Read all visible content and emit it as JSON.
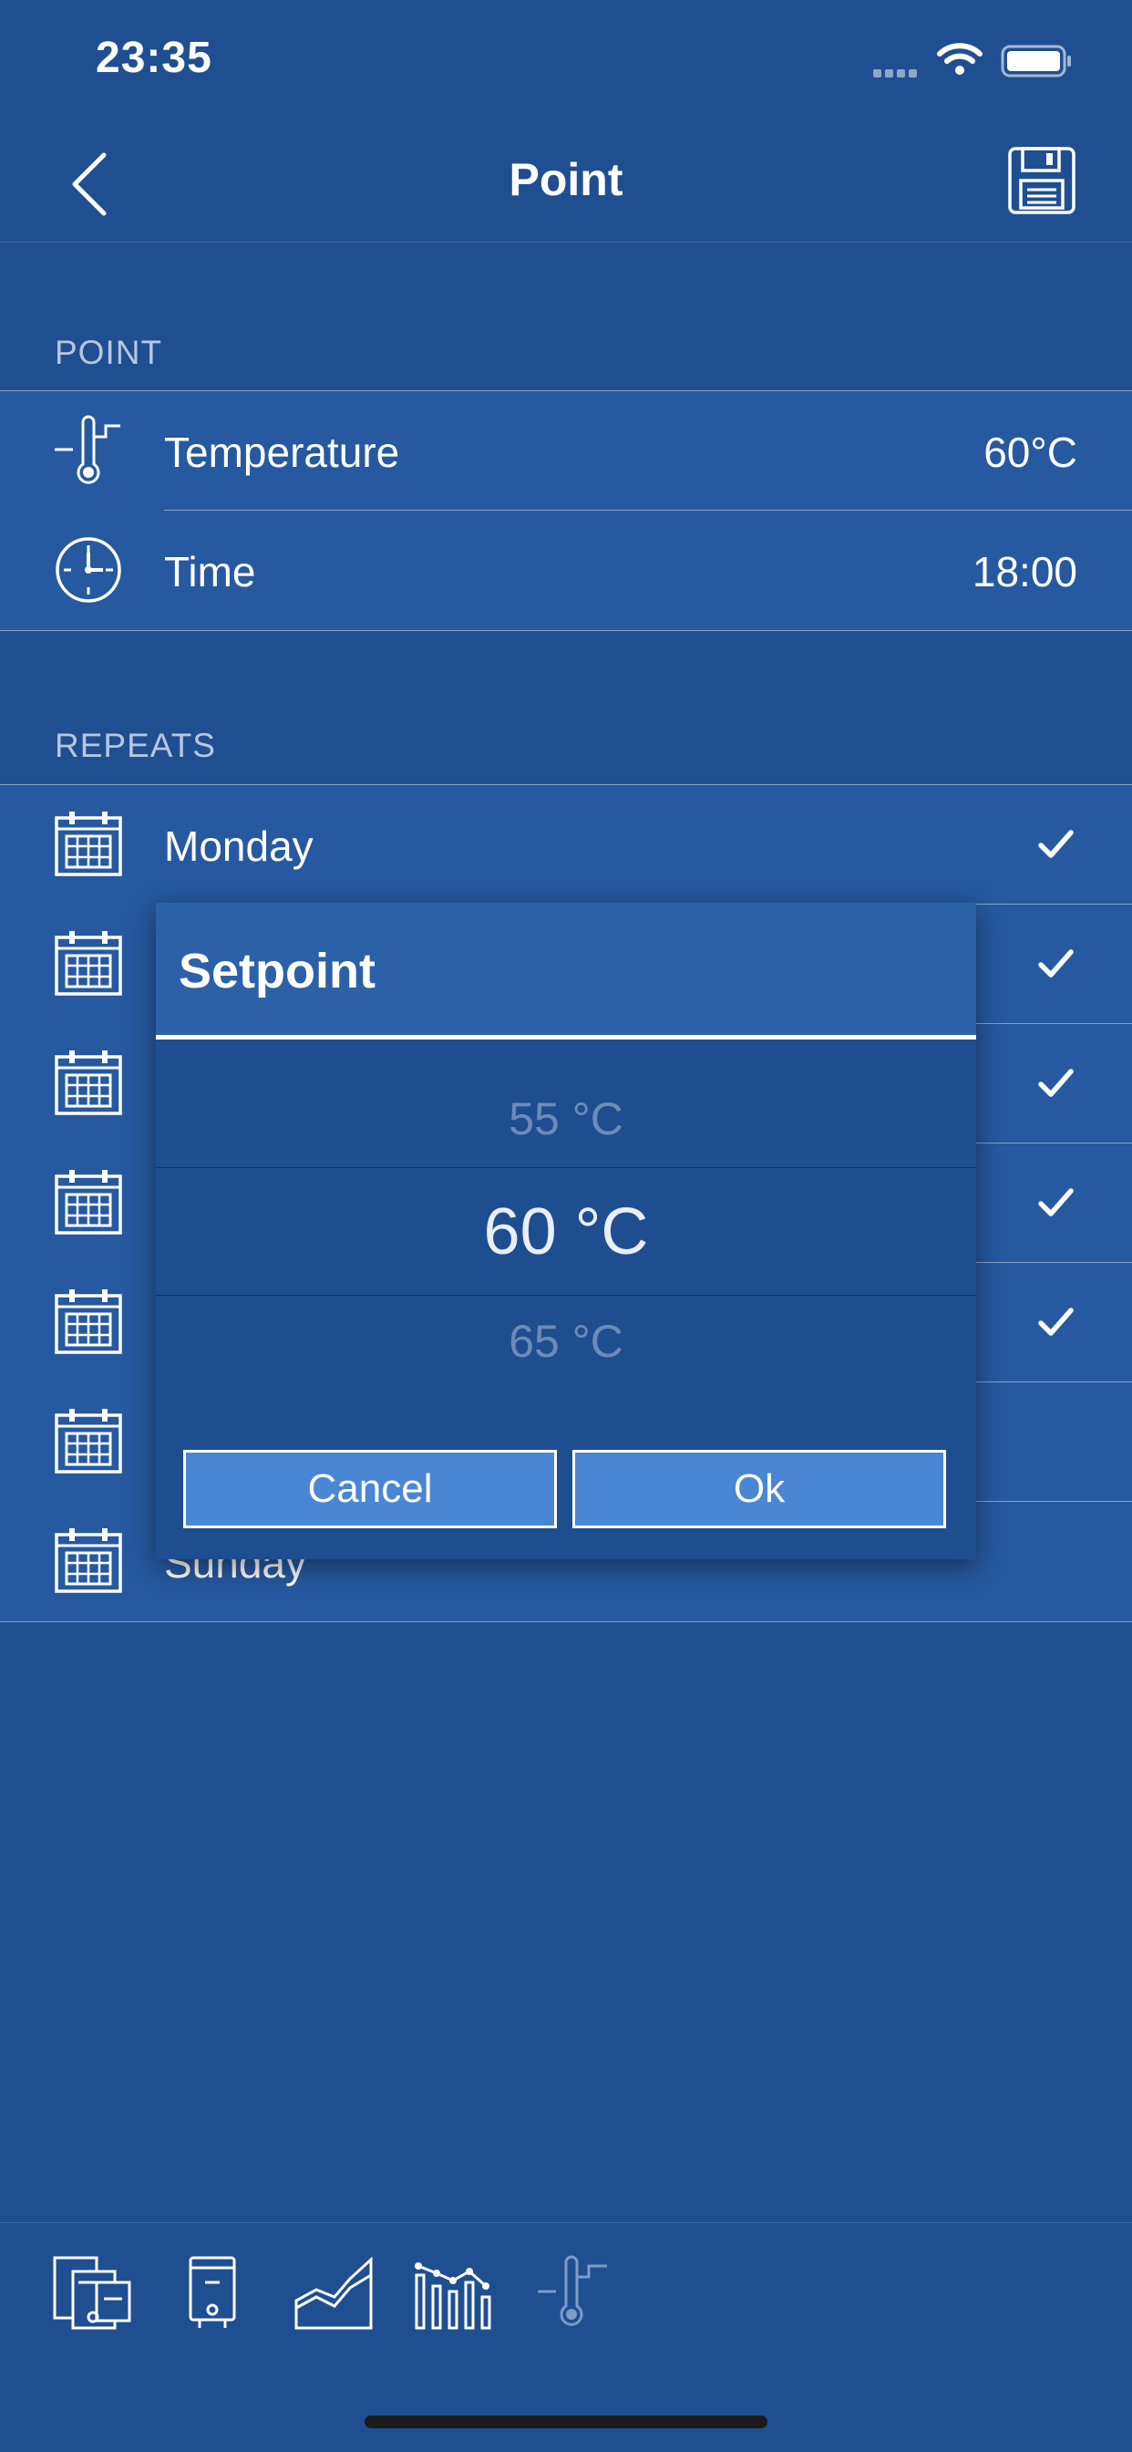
{
  "status_bar": {
    "time": "23:35"
  },
  "nav": {
    "title": "Point"
  },
  "point_section": {
    "header": "POINT",
    "rows": [
      {
        "label": "Temperature",
        "value": "60°C",
        "icon": "thermometer-icon"
      },
      {
        "label": "Time",
        "value": "18:00",
        "icon": "clock-icon"
      }
    ]
  },
  "repeats_section": {
    "header": "REPEATS",
    "days": [
      {
        "label": "Monday",
        "checked": true
      },
      {
        "label": "",
        "checked": true
      },
      {
        "label": "",
        "checked": true
      },
      {
        "label": "",
        "checked": true
      },
      {
        "label": "",
        "checked": true
      },
      {
        "label": "",
        "checked": false
      },
      {
        "label": "Sunday",
        "checked": false
      }
    ]
  },
  "dialog": {
    "title": "Setpoint",
    "picker": {
      "previous": "55 °C",
      "selected": "60 °C",
      "next": "65 °C"
    },
    "cancel_label": "Cancel",
    "ok_label": "Ok"
  },
  "tab_bar": {
    "tabs": [
      {
        "icon": "devices-icon",
        "active": false
      },
      {
        "icon": "boiler-icon",
        "active": false
      },
      {
        "icon": "area-chart-icon",
        "active": false
      },
      {
        "icon": "bar-line-chart-icon",
        "active": false
      },
      {
        "icon": "thermometer-icon",
        "active": true
      }
    ]
  },
  "colors": {
    "background": "#1f4f91",
    "row": "#2659a0",
    "dialog_header": "#2c61a8",
    "button": "#4a86d4"
  }
}
